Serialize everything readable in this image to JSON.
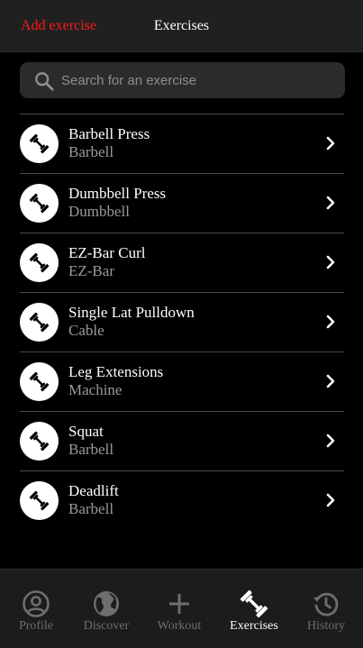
{
  "colors": {
    "accent": "#ff1a1a",
    "background": "#000000",
    "header": "#202020",
    "tabbar": "#1c1c1c",
    "secondary_text": "#9a9a9a",
    "inactive_tab": "#6e6e6e"
  },
  "header": {
    "add_label": "Add exercise",
    "title": "Exercises"
  },
  "search": {
    "icon": "search-icon",
    "placeholder": "Search for an exercise",
    "value": ""
  },
  "exercises": [
    {
      "name": "Barbell Press",
      "equipment": "Barbell",
      "icon": "dumbbell-icon"
    },
    {
      "name": "Dumbbell Press",
      "equipment": "Dumbbell",
      "icon": "dumbbell-icon"
    },
    {
      "name": "EZ-Bar Curl",
      "equipment": "EZ-Bar",
      "icon": "dumbbell-icon"
    },
    {
      "name": "Single Lat Pulldown",
      "equipment": "Cable",
      "icon": "dumbbell-icon"
    },
    {
      "name": "Leg Extensions",
      "equipment": "Machine",
      "icon": "dumbbell-icon"
    },
    {
      "name": "Squat",
      "equipment": "Barbell",
      "icon": "dumbbell-icon"
    },
    {
      "name": "Deadlift",
      "equipment": "Barbell",
      "icon": "dumbbell-icon"
    }
  ],
  "tabs": [
    {
      "label": "Profile",
      "icon": "profile-icon",
      "active": false
    },
    {
      "label": "Discover",
      "icon": "globe-icon",
      "active": false
    },
    {
      "label": "Workout",
      "icon": "plus-icon",
      "active": false
    },
    {
      "label": "Exercises",
      "icon": "dumbbell-icon",
      "active": true
    },
    {
      "label": "History",
      "icon": "history-icon",
      "active": false
    }
  ]
}
